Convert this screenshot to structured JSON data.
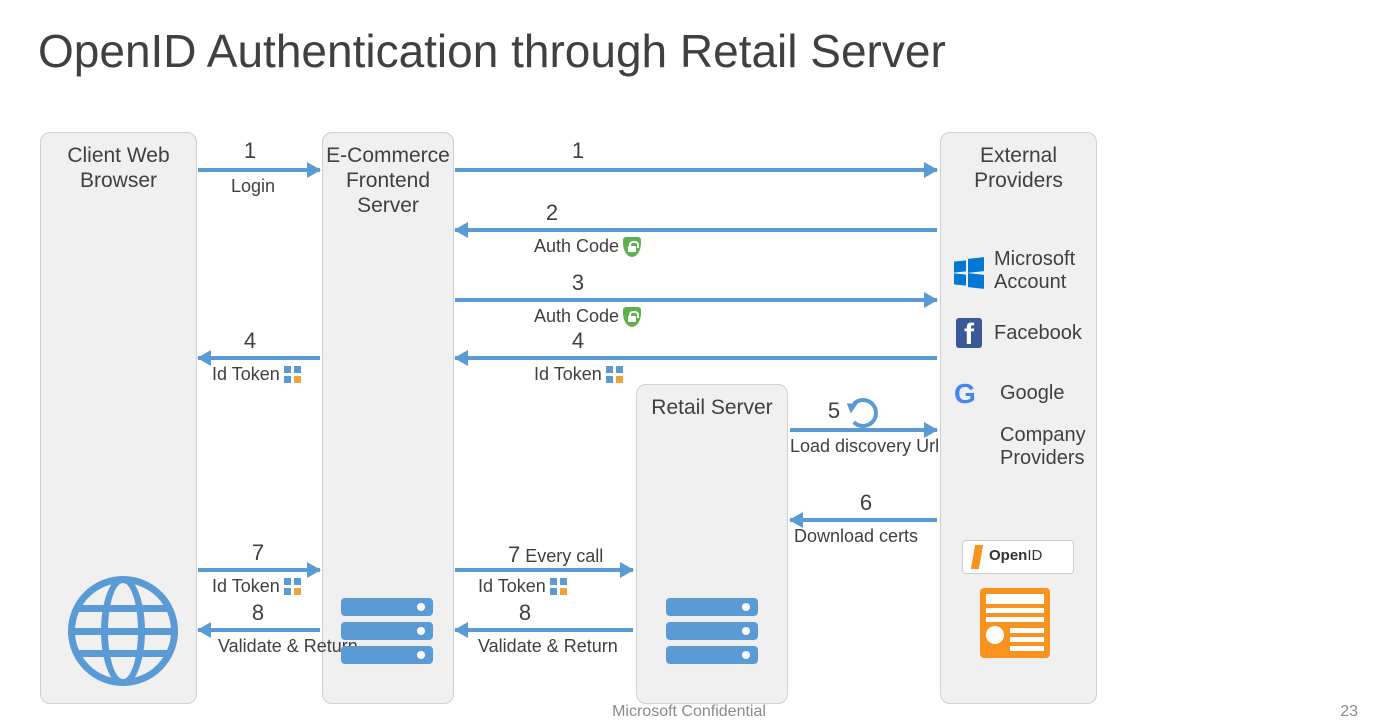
{
  "title": "OpenID Authentication through Retail Server",
  "footer_center": "Microsoft Confidential",
  "footer_right": "23",
  "boxes": {
    "client": "Client Web Browser",
    "ecomm": "E-Commerce Frontend Server",
    "retail": "Retail Server",
    "external": "External Providers"
  },
  "arrows": {
    "a1a": {
      "num": "1",
      "lbl": "Login"
    },
    "a1b": {
      "num": "1"
    },
    "a2": {
      "num": "2",
      "lbl": "Auth Code"
    },
    "a3": {
      "num": "3",
      "lbl": "Auth Code"
    },
    "a4a": {
      "num": "4",
      "lbl": "Id Token"
    },
    "a4b": {
      "num": "4",
      "lbl": "Id Token"
    },
    "a5": {
      "num": "5",
      "lbl": "Load discovery Url"
    },
    "a6": {
      "num": "6",
      "lbl": "Download certs"
    },
    "a7a": {
      "num": "7",
      "lbl": "Id Token"
    },
    "a7b": {
      "num": "7",
      "extra": "Every call",
      "lbl": "Id Token"
    },
    "a8a": {
      "num": "8",
      "lbl": "Validate & Return"
    },
    "a8b": {
      "num": "8",
      "lbl": "Validate & Return"
    }
  },
  "providers": {
    "ms": "Microsoft Account",
    "fb": "Facebook",
    "gg": "Google",
    "comp": "Company Providers",
    "openid": "OpenID"
  }
}
